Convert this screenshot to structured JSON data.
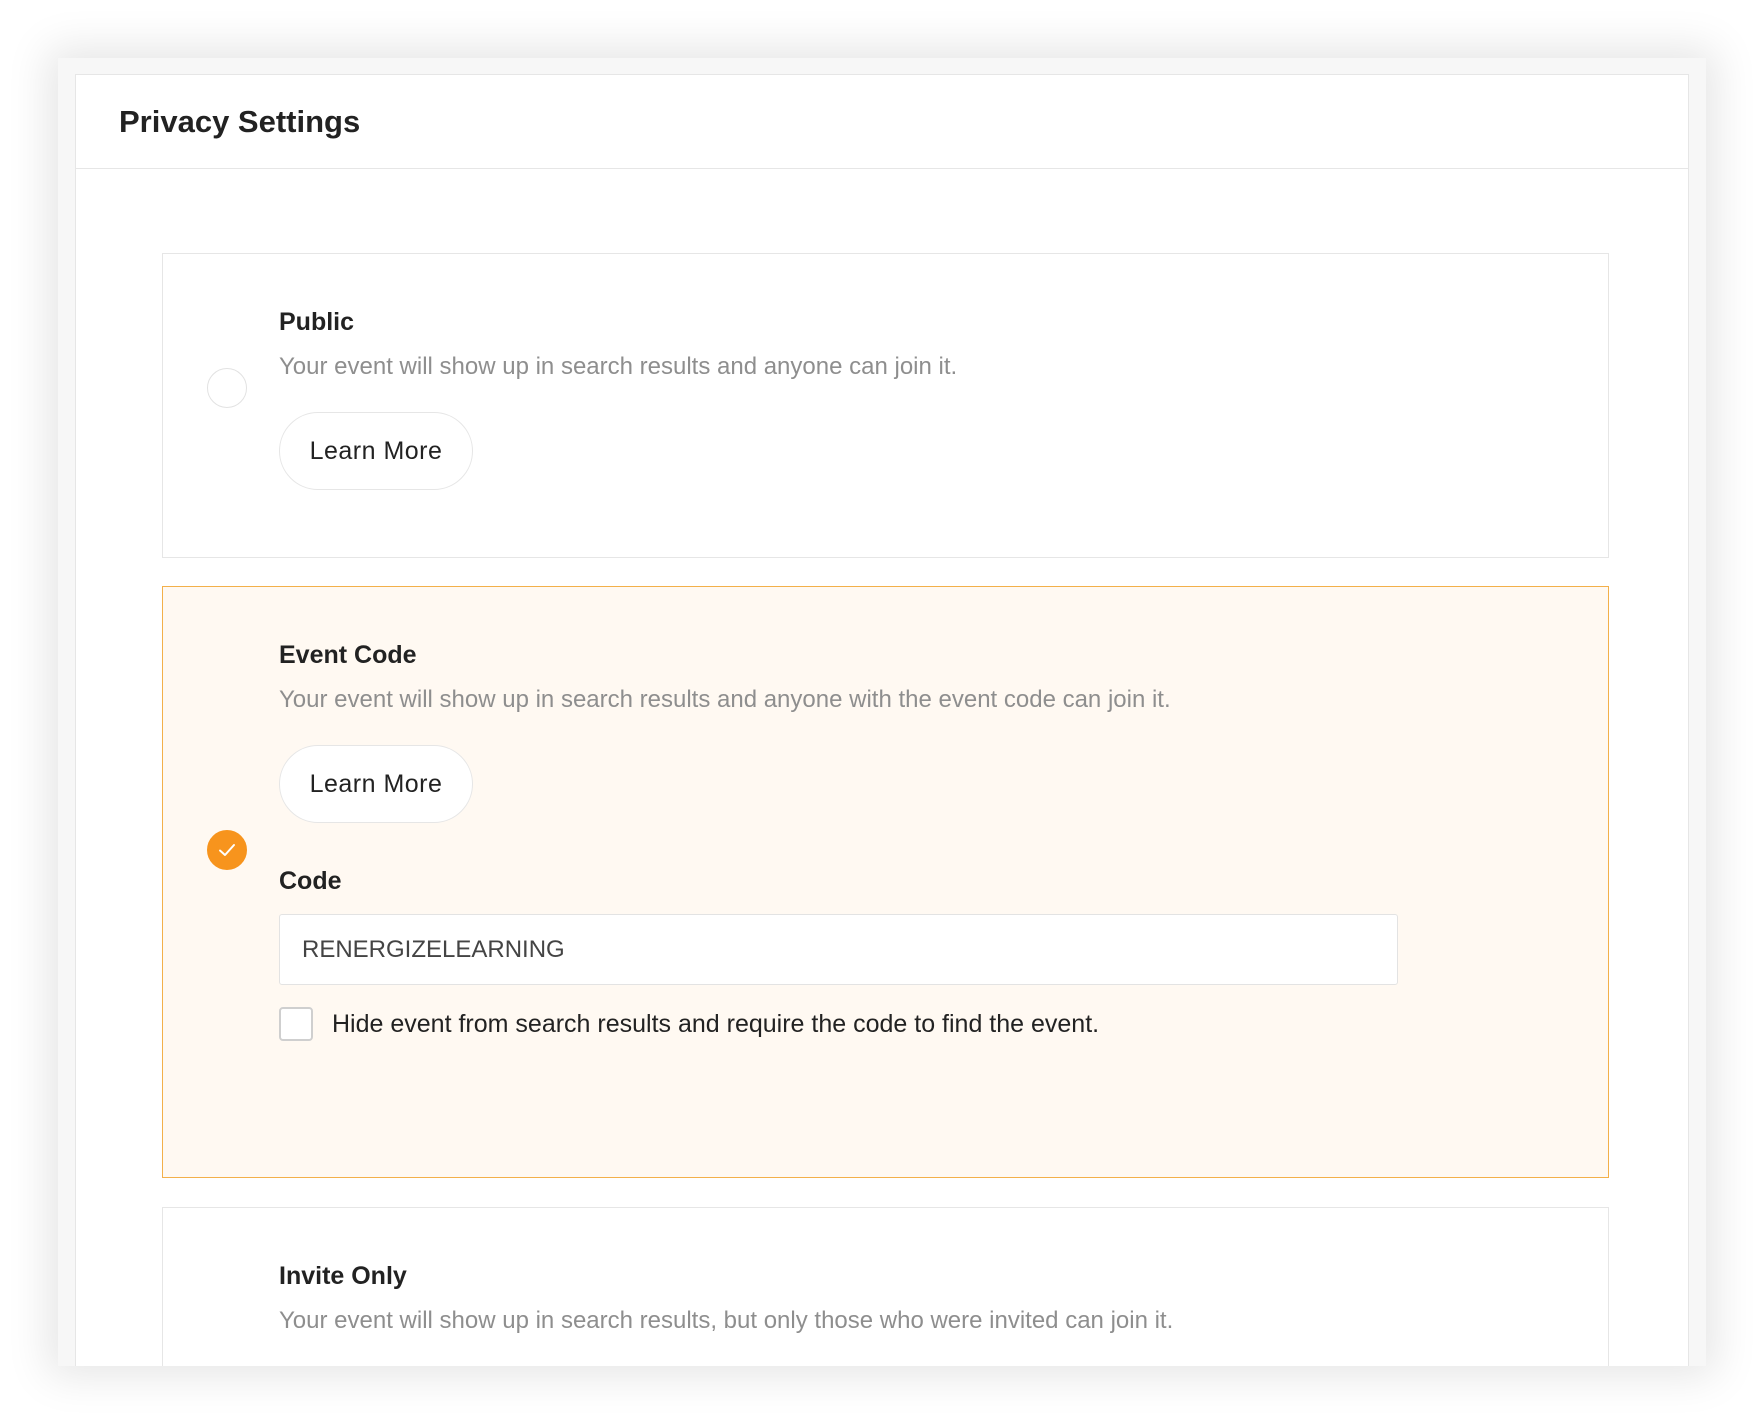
{
  "header": {
    "title": "Privacy Settings"
  },
  "options": [
    {
      "title": "Public",
      "description": "Your event will show up in search results and anyone can join it.",
      "learn_more_label": "Learn More",
      "selected": false
    },
    {
      "title": "Event Code",
      "description": "Your event will show up in search results and anyone with the event code can join it.",
      "learn_more_label": "Learn More",
      "selected": true,
      "code_label": "Code",
      "code_value": "RENERGIZELEARNING",
      "hide_checkbox_label": "Hide event from search results and require the code to find the event.",
      "hide_checkbox_checked": false
    },
    {
      "title": "Invite Only",
      "description": "Your event will show up in search results, but only those who were invited can join it.",
      "selected": false
    }
  ],
  "colors": {
    "accent": "#f7941d",
    "selected_border": "#f3b04a",
    "selected_background": "#fff9f2",
    "muted_text": "#8e8e8e"
  }
}
